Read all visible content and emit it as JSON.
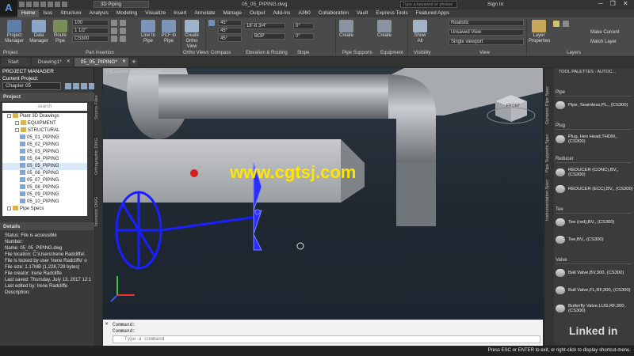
{
  "app": {
    "logo": "A",
    "workspace": "3D Piping",
    "file_title": "05_05_PIPING.dwg",
    "search_placeholder": "Type a keyword or phrase",
    "signin": "Sign In"
  },
  "ribbon_tabs": [
    "Home",
    "Isos",
    "Structure",
    "Analysis",
    "Modeling",
    "Visualize",
    "Insert",
    "Annotate",
    "Manage",
    "Output",
    "Add-ins",
    "A360",
    "Collaboration",
    "Vault",
    "Express Tools",
    "Featured Apps"
  ],
  "ribbon": {
    "buttons": {
      "project_manager": "Project Manager",
      "data_manager": "Data Manager",
      "route_pipe": "Route Pipe",
      "line_to_pipe": "Line to Pipe",
      "pcf_to_pipe": "PCF to Pipe",
      "create_ortho": "Create Ortho View",
      "create_supports": "Create",
      "create_equipment": "Create",
      "show_all": "Show All",
      "layer_props": "Layer Properties",
      "make_current": "Make Current",
      "match_layer": "Match Layer"
    },
    "fields": {
      "size": "100",
      "sub": "1 1/2\"",
      "spec": "CS300",
      "angle1": "45°",
      "angle2": "45°",
      "angle3": "45°",
      "elev": "16'-8 3/4\"",
      "bop": "BOP",
      "slope1": "0°",
      "slope2": "0°",
      "visual_style": "Realistic",
      "view": "Unsaved View",
      "viewport": "Single viewport"
    },
    "panels": [
      "Project",
      "Part Insertion",
      "Ortho Views",
      "Compass",
      "Elevation & Routing",
      "Slope",
      "Pipe Supports",
      "Equipment",
      "Visibility",
      "View",
      "Layers"
    ]
  },
  "doc_tabs": [
    {
      "label": "Start"
    },
    {
      "label": "Drawing1*"
    },
    {
      "label": "05_05_PIPING*"
    }
  ],
  "project_manager": {
    "title": "PROJECT MANAGER",
    "current_project_label": "Current Project:",
    "current_project": "Chapter 05",
    "section": "Project",
    "search": "search",
    "tree": [
      "Plant 3D Drawings",
      "EQUIPMENT",
      "STRUCTURAL",
      "05_01_PIPING",
      "05_02_PIPING",
      "05_03_PIPING",
      "05_04_PIPING",
      "05_05_PIPING",
      "05_06_PIPING",
      "05_07_PIPING",
      "05_08_PIPING",
      "05_09_PIPING",
      "05_10_PIPING",
      "Pipe Specs"
    ]
  },
  "side_tabs": [
    "Source Files",
    "Orthographic DWG",
    "Isometric DWG"
  ],
  "details": {
    "title": "Details",
    "lines": [
      "Status: File is accessible",
      "Number:",
      "Name: 05_05_PIPING.dwg",
      "File location: C:\\Users\\Irene Radcliffe\\",
      "File is locked by user 'Irene Radcliffe' o",
      "File size: 1.17MB (1,228,729 bytes)",
      "File creator: Irene Radcliffe",
      "Last saved: Thursday, July 13, 2017 12:1",
      "Last edited by: Irene Radcliffe",
      "Description:"
    ]
  },
  "viewport": {
    "label": "[-][Custom View][Realistic]",
    "viewcube": "FRONT"
  },
  "command": {
    "line1": "Command:",
    "line2": "Command:",
    "placeholder": "Type a command"
  },
  "tool_palette": {
    "title": "TOOL PALETTES - AUTOC...",
    "vtabs": [
      "Dynamic Pipe Spec",
      "Pipe Supports Spec",
      "Instrumentation Spec"
    ],
    "categories": [
      {
        "name": "Pipe",
        "items": [
          "Pipe, Seamless,PL,, (CS300)"
        ]
      },
      {
        "name": "Plug",
        "items": [
          "Plug, Hex Head,THDM,, (CS300)"
        ]
      },
      {
        "name": "Reducer",
        "items": [
          "REDUCER (CONC),BV,, (CS300)",
          "REDUCER (ECC),BV,, (CS300)"
        ]
      },
      {
        "name": "Tee",
        "items": [
          "Tee (red),BV,, (CS300)",
          "Tee,BV,, (CS300)"
        ]
      },
      {
        "name": "Valve",
        "items": [
          "Ball Valve,BV,300, (CS300)",
          "Ball Valve,FL,RF,300, (CS300)",
          "Butterfly Valve,LUG,RF,300, (CS300)"
        ]
      }
    ]
  },
  "status": "Press ESC or ENTER to exit, or right-click to display shortcut-menu.",
  "watermark": "www.cgtsj.com",
  "brand": "Linked in",
  "colors": {
    "valve_blue": "#1a1fff",
    "pipe_gray": "#b9bcc0",
    "accent_yellow": "#ffe600"
  }
}
